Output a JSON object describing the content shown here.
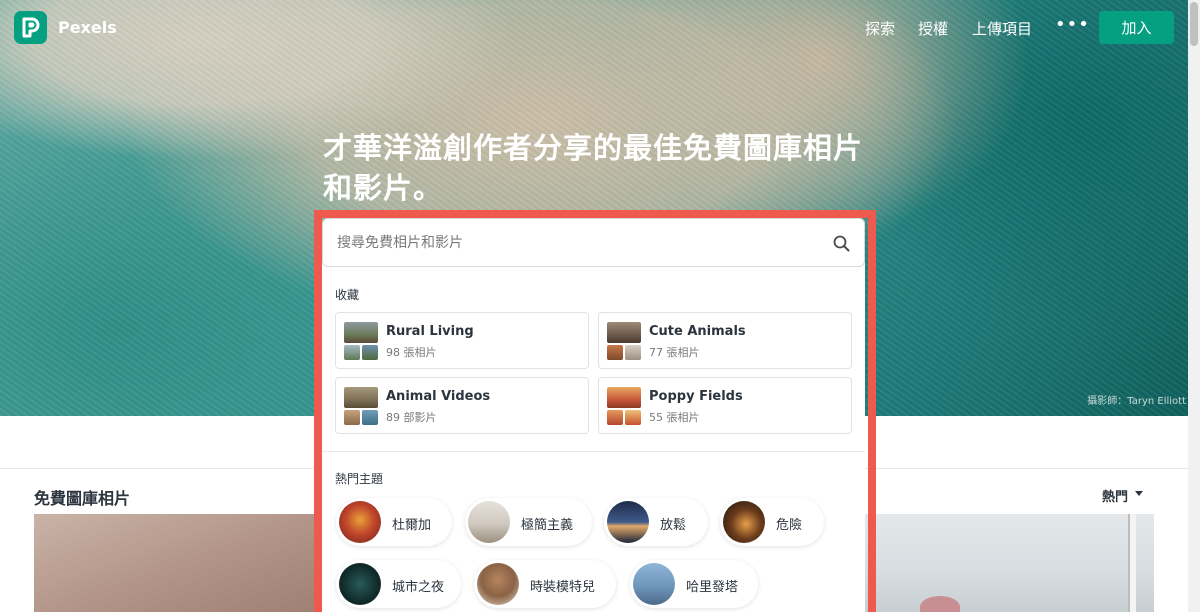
{
  "nav": {
    "brand": "Pexels",
    "links": [
      "探索",
      "授權",
      "上傳項目"
    ],
    "more": "•••",
    "join": "加入"
  },
  "hero": {
    "headline": "才華洋溢創作者分享的最佳免費圖庫相片和影片。",
    "credit": "攝影師：Taryn Elliott"
  },
  "search": {
    "placeholder": "搜尋免費相片和影片"
  },
  "collections": {
    "label": "收藏",
    "items": [
      {
        "title": "Rural Living",
        "count": "98 張相片"
      },
      {
        "title": "Cute Animals",
        "count": "77 張相片"
      },
      {
        "title": "Animal Videos",
        "count": "89 部影片"
      },
      {
        "title": "Poppy Fields",
        "count": "55 張相片"
      }
    ]
  },
  "topics": {
    "label": "熱門主題",
    "items": [
      {
        "label": "杜爾加"
      },
      {
        "label": "極簡主義"
      },
      {
        "label": "放鬆"
      },
      {
        "label": "危險"
      },
      {
        "label": "城市之夜"
      },
      {
        "label": "時裝模特兒"
      },
      {
        "label": "哈里發塔"
      }
    ]
  },
  "main": {
    "section_title": "免費圖庫相片",
    "sort": "熱門"
  },
  "colors": {
    "brand": "#05a081",
    "highlight": "#ef5a4f"
  }
}
